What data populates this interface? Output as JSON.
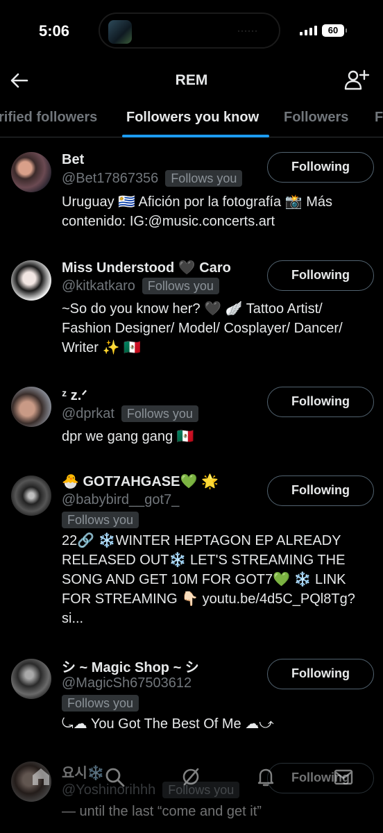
{
  "status_bar": {
    "time": "5:06",
    "battery": "60"
  },
  "header": {
    "title": "REM"
  },
  "tabs": [
    {
      "label": "rified followers",
      "active": false
    },
    {
      "label": "Followers you know",
      "active": true
    },
    {
      "label": "Followers",
      "active": false
    },
    {
      "label": "F",
      "active": false
    }
  ],
  "users": [
    {
      "name": "Bet",
      "handle": "@Bet17867356",
      "badge": "Follows you",
      "bio": "Uruguay 🇺🇾 Afición por la fotografía 📸 Más contenido: IG:@music.concerts.art",
      "button": "Following"
    },
    {
      "name": "Miss Understood 🖤 Caro",
      "handle": "@kitkatkaro",
      "badge": "Follows you",
      "bio": "~So do you know her? 🖤 🪽 Tattoo Artist/ Fashion Designer/ Model/ Cosplayer/ Dancer/ Writer ✨ 🇲🇽",
      "button": "Following"
    },
    {
      "name": "ᶻ z.ᐟ",
      "handle": "@dprkat",
      "badge": "Follows you",
      "bio": "dpr we gang gang 🇲🇽",
      "button": "Following"
    },
    {
      "name": "🐣 GOT7AHGASE💚 🌟",
      "handle": "@babybird__got7_",
      "badge": "Follows you",
      "bio": "22🔗 ❄️WINTER HEPTAGON EP ALREADY RELEASED OUT❄️ LET'S STREAMING THE SONG AND GET 10M FOR GOT7💚 ❄️ LINK FOR STREAMING 👇🏻 youtu.be/4d5C_PQl8Tg?si...",
      "button": "Following"
    },
    {
      "name": "シ ~ Magic Shop ~ シ",
      "handle": "@MagicSh67503612",
      "badge": "Follows you",
      "bio": "⤿☁︎ You Got The Best Of Me ☁︎⤻",
      "button": "Following"
    },
    {
      "name": "요시❄️",
      "handle": "@Yoshinorihhh",
      "badge": "Follows you",
      "bio": "— until the last “come and get it”",
      "button": "Following"
    }
  ],
  "bottom_nav": [
    "home-icon",
    "search-icon",
    "grok-icon",
    "notifications-icon",
    "messages-icon"
  ],
  "colors": {
    "accent": "#1d9bf0",
    "background": "#000000",
    "muted": "#71767b",
    "badge_bg": "#2f3336"
  }
}
